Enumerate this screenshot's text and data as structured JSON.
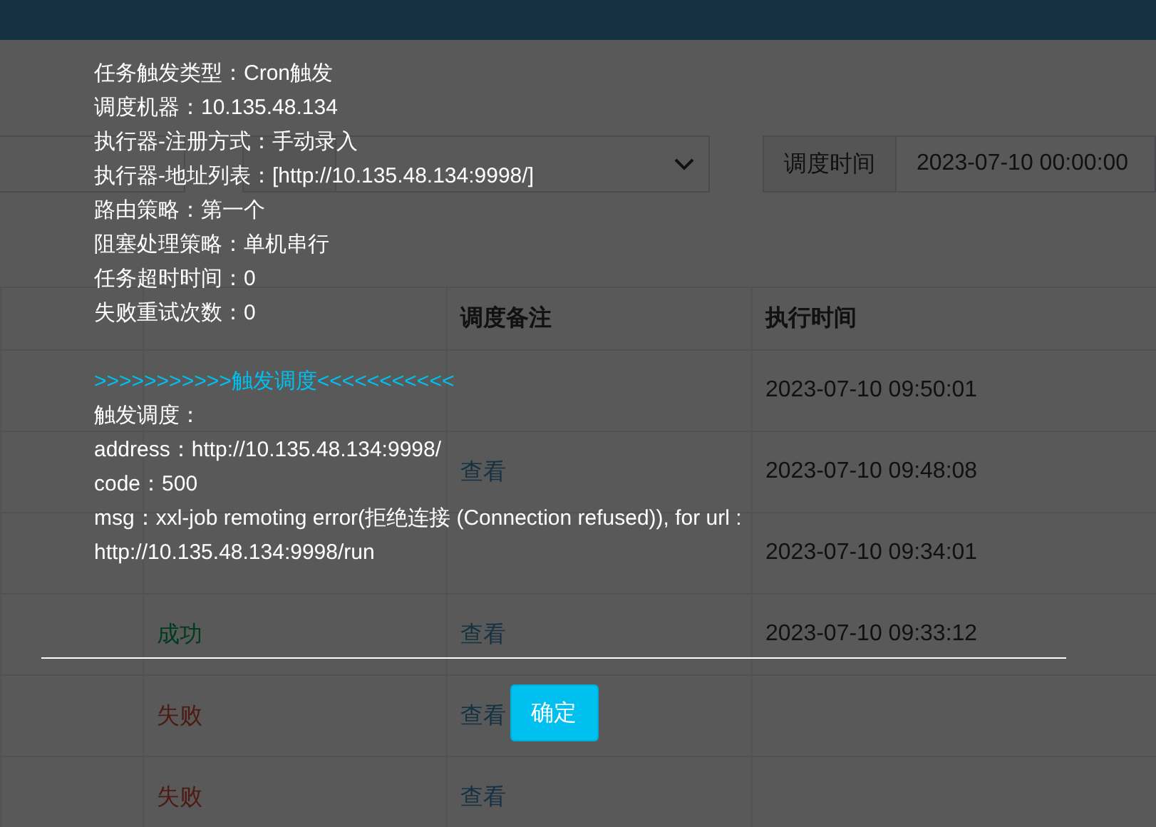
{
  "filters": {
    "time_label": "调度时间",
    "time_value": "2023-07-10 00:00:00"
  },
  "table": {
    "columns": [
      "调度备注",
      "执行时间"
    ],
    "rows": [
      {
        "time": "2023-07-10 09:50:01"
      },
      {
        "view": "查看",
        "time": "2023-07-10 09:48:08"
      },
      {
        "time": "2023-07-10 09:34:01"
      },
      {
        "result": {
          "text": "成功",
          "kind": "success"
        },
        "view": "查看",
        "time": "2023-07-10 09:33:12"
      },
      {
        "result": {
          "text": "失败",
          "kind": "fail"
        },
        "view": "查看"
      },
      {
        "result": {
          "text": "失败",
          "kind": "fail"
        },
        "view": "查看"
      }
    ]
  },
  "dialog": {
    "lines": [
      "任务触发类型：Cron触发",
      "调度机器：10.135.48.134",
      "执行器-注册方式：手动录入",
      "执行器-地址列表：[http://10.135.48.134:9998/]",
      "路由策略：第一个",
      "阻塞处理策略：单机串行",
      "任务超时时间：0",
      "失败重试次数：0"
    ],
    "heading": ">>>>>>>>>>>触发调度<<<<<<<<<<<",
    "trigger_lines": [
      "触发调度：",
      "address：http://10.135.48.134:9998/",
      "code：500",
      "msg：xxl-job remoting error(拒绝连接 (Connection refused)), for url : http://10.135.48.134:9998/run"
    ],
    "button": "确定"
  }
}
